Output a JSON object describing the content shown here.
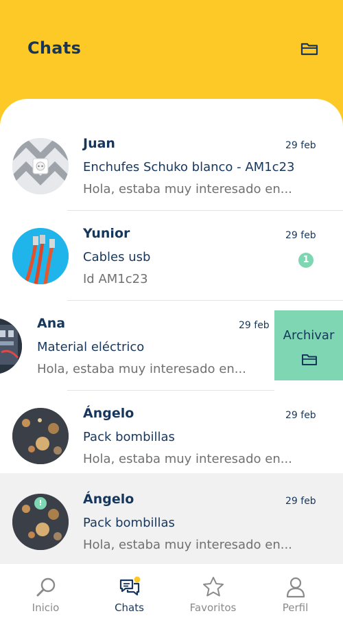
{
  "header": {
    "title": "Chats",
    "icon": "folder-icon"
  },
  "chats": [
    {
      "name": "Juan",
      "date": "29 feb",
      "subject": "Enchufes Schuko blanco - AM1c23",
      "preview": "Hola, estaba muy interesado en...",
      "avatar": "socket-product-avatar"
    },
    {
      "name": "Yunior",
      "date": "29 feb",
      "subject": "Cables usb",
      "preview": "Id AM1c23",
      "unread": "1",
      "avatar": "usb-cables-avatar"
    },
    {
      "name": "Ana",
      "date": "29 feb",
      "subject": "Material eléctrico",
      "preview": "Hola, estaba muy interesado en...",
      "avatar": "electrical-material-avatar"
    },
    {
      "name": "Ángelo",
      "date": "29 feb",
      "subject": "Pack bombillas",
      "preview": "Hola, estaba muy interesado en...",
      "avatar": "bulbs-avatar"
    },
    {
      "name": "Ángelo",
      "date": "29 feb",
      "subject": "Pack bombillas",
      "preview": "Hola, estaba muy interesado en...",
      "avatar": "bulbs-avatar",
      "avatar_badge": "!"
    }
  ],
  "swipe_action": {
    "label": "Archivar",
    "icon": "folder-icon"
  },
  "tabs": [
    {
      "label": "Inicio",
      "icon": "search-icon"
    },
    {
      "label": "Chats",
      "icon": "chat-bubbles-icon",
      "active": true
    },
    {
      "label": "Favoritos",
      "icon": "star-icon"
    },
    {
      "label": "Perfil",
      "icon": "user-icon"
    }
  ],
  "colors": {
    "header_bg": "#fcc927",
    "accent_green": "#7fd6b2",
    "text_dark": "#17365c",
    "text_muted": "#707070",
    "notify_dot": "#fcc927"
  }
}
